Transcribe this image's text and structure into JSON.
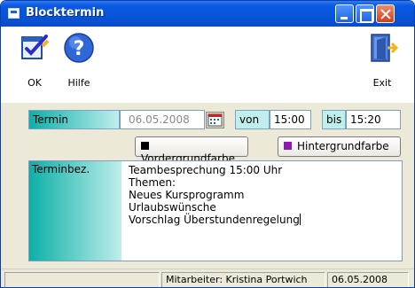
{
  "window": {
    "title": "Blocktermin"
  },
  "toolbar": {
    "ok_label": "OK",
    "help_label": "Hilfe",
    "exit_label": "Exit"
  },
  "termin": {
    "label": "Termin",
    "date": "06.05.2008",
    "von_label": "von",
    "von_value": "15:00",
    "bis_label": "bis",
    "bis_value": "15:20"
  },
  "colors": {
    "fg_label": "Vordergrundfarbe",
    "fg_swatch": "#000000",
    "bg_label": "Hintergrundfarbe",
    "bg_swatch": "#8a1cb0"
  },
  "description": {
    "label": "Terminbez.",
    "lines": [
      "Teambesprechung 15:00 Uhr",
      "Themen:",
      "Neues Kursprogramm",
      "Urlaubswünsche",
      "Vorschlag Überstundenregelung"
    ]
  },
  "status": {
    "employee": "Mitarbeiter:  Kristina Portwich",
    "date": "06.05.2008"
  },
  "icons": {
    "ok": "notepad-check-icon",
    "help": "question-icon",
    "exit": "door-exit-icon",
    "calendar": "calendar-icon"
  }
}
